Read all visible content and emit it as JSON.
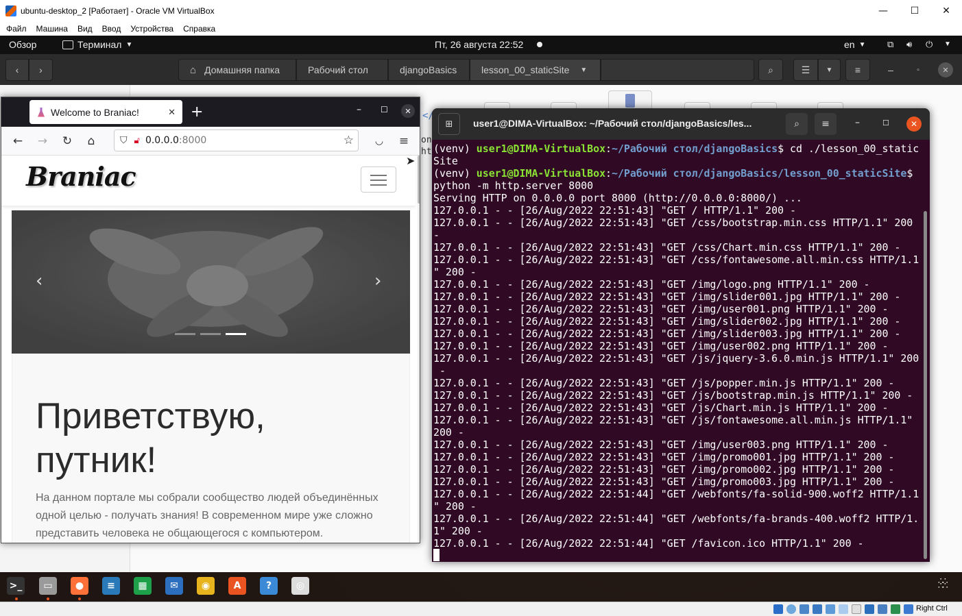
{
  "vbox": {
    "title": "ubuntu-desktop_2 [Работает] - Oracle VM VirtualBox",
    "menu": [
      "Файл",
      "Машина",
      "Вид",
      "Ввод",
      "Устройства",
      "Справка"
    ],
    "host_key": "Right Ctrl",
    "window_controls": {
      "minimize": "—",
      "maximize": "☐",
      "close": "✕"
    }
  },
  "topbar": {
    "activities": "Обзор",
    "app_menu": "Терминал",
    "clock": "Пт, 26 августа  22:52",
    "lang": "en"
  },
  "nautilus": {
    "breadcrumbs": [
      "Домашняя папка",
      "Рабочий стол",
      "djangoBasics",
      "lesson_00_staticSite"
    ],
    "partial_texts": [
      "</",
      "ont",
      "ht"
    ]
  },
  "firefox": {
    "tab_title": "Welcome to Braniac!",
    "url_host": "0.0.0.0",
    "url_port": ":8000",
    "site": {
      "brand": "Braniac",
      "hero_title": "Приветствую, путник!",
      "hero_text": "На данном портале мы собрали сообщество людей объединённых одной целью - получать знания! В современном мире уже сложно представить человека не общающегося с компьютером.",
      "carousel_indicators": 3,
      "carousel_active": 3
    }
  },
  "terminal": {
    "title": "user1@DIMA-VirtualBox: ~/Рабочий стол/djangoBasics/les...",
    "prompt1": {
      "venv": "(venv) ",
      "user": "user1@DIMA-VirtualBox",
      "path": "~/Рабочий стол/djangoBasics",
      "cmd": "$ cd ./lesson_00_static",
      "wrap": "Site"
    },
    "prompt2": {
      "venv": "(venv) ",
      "user": "user1@DIMA-VirtualBox",
      "path": "~/Рабочий стол/djangoBasics/lesson_00_staticSite",
      "cmd": "$",
      "wrap": "python -m http.server 8000"
    },
    "output": [
      "Serving HTTP on 0.0.0.0 port 8000 (http://0.0.0.0:8000/) ...",
      "127.0.0.1 - - [26/Aug/2022 22:51:43] \"GET / HTTP/1.1\" 200 -",
      "127.0.0.1 - - [26/Aug/2022 22:51:43] \"GET /css/bootstrap.min.css HTTP/1.1\" 200",
      "-",
      "127.0.0.1 - - [26/Aug/2022 22:51:43] \"GET /css/Chart.min.css HTTP/1.1\" 200 -",
      "127.0.0.1 - - [26/Aug/2022 22:51:43] \"GET /css/fontawesome.all.min.css HTTP/1.1",
      "\" 200 -",
      "127.0.0.1 - - [26/Aug/2022 22:51:43] \"GET /img/logo.png HTTP/1.1\" 200 -",
      "127.0.0.1 - - [26/Aug/2022 22:51:43] \"GET /img/slider001.jpg HTTP/1.1\" 200 -",
      "127.0.0.1 - - [26/Aug/2022 22:51:43] \"GET /img/user001.png HTTP/1.1\" 200 -",
      "127.0.0.1 - - [26/Aug/2022 22:51:43] \"GET /img/slider002.jpg HTTP/1.1\" 200 -",
      "127.0.0.1 - - [26/Aug/2022 22:51:43] \"GET /img/slider003.jpg HTTP/1.1\" 200 -",
      "127.0.0.1 - - [26/Aug/2022 22:51:43] \"GET /img/user002.png HTTP/1.1\" 200 -",
      "127.0.0.1 - - [26/Aug/2022 22:51:43] \"GET /js/jquery-3.6.0.min.js HTTP/1.1\" 200",
      " -",
      "127.0.0.1 - - [26/Aug/2022 22:51:43] \"GET /js/popper.min.js HTTP/1.1\" 200 -",
      "127.0.0.1 - - [26/Aug/2022 22:51:43] \"GET /js/bootstrap.min.js HTTP/1.1\" 200 -",
      "127.0.0.1 - - [26/Aug/2022 22:51:43] \"GET /js/Chart.min.js HTTP/1.1\" 200 -",
      "127.0.0.1 - - [26/Aug/2022 22:51:43] \"GET /js/fontawesome.all.min.js HTTP/1.1\"",
      "200 -",
      "127.0.0.1 - - [26/Aug/2022 22:51:43] \"GET /img/user003.png HTTP/1.1\" 200 -",
      "127.0.0.1 - - [26/Aug/2022 22:51:43] \"GET /img/promo001.jpg HTTP/1.1\" 200 -",
      "127.0.0.1 - - [26/Aug/2022 22:51:43] \"GET /img/promo002.jpg HTTP/1.1\" 200 -",
      "127.0.0.1 - - [26/Aug/2022 22:51:43] \"GET /img/promo003.jpg HTTP/1.1\" 200 -",
      "127.0.0.1 - - [26/Aug/2022 22:51:44] \"GET /webfonts/fa-solid-900.woff2 HTTP/1.1",
      "\" 200 -",
      "127.0.0.1 - - [26/Aug/2022 22:51:44] \"GET /webfonts/fa-brands-400.woff2 HTTP/1.",
      "1\" 200 -",
      "127.0.0.1 - - [26/Aug/2022 22:51:44] \"GET /favicon.ico HTTP/1.1\" 200 -"
    ]
  },
  "dock": {
    "apps": [
      {
        "name": "terminal",
        "glyph": ">_",
        "color": "#333333"
      },
      {
        "name": "files",
        "glyph": "▭",
        "color": "#9a9a9a"
      },
      {
        "name": "firefox",
        "glyph": "●",
        "color": "#ff7139"
      },
      {
        "name": "writer",
        "glyph": "≡",
        "color": "#2a7ab9"
      },
      {
        "name": "calc",
        "glyph": "▦",
        "color": "#1e9f4a"
      },
      {
        "name": "thunderbird",
        "glyph": "✉",
        "color": "#2d6fbf"
      },
      {
        "name": "rhythmbox",
        "glyph": "◉",
        "color": "#e8b41d"
      },
      {
        "name": "software",
        "glyph": "A",
        "color": "#e95420"
      },
      {
        "name": "help",
        "glyph": "?",
        "color": "#3b8ad8"
      },
      {
        "name": "dvd",
        "glyph": "◎",
        "color": "#dddddd"
      }
    ],
    "show_apps_glyph": "⋮⋮⋮"
  }
}
